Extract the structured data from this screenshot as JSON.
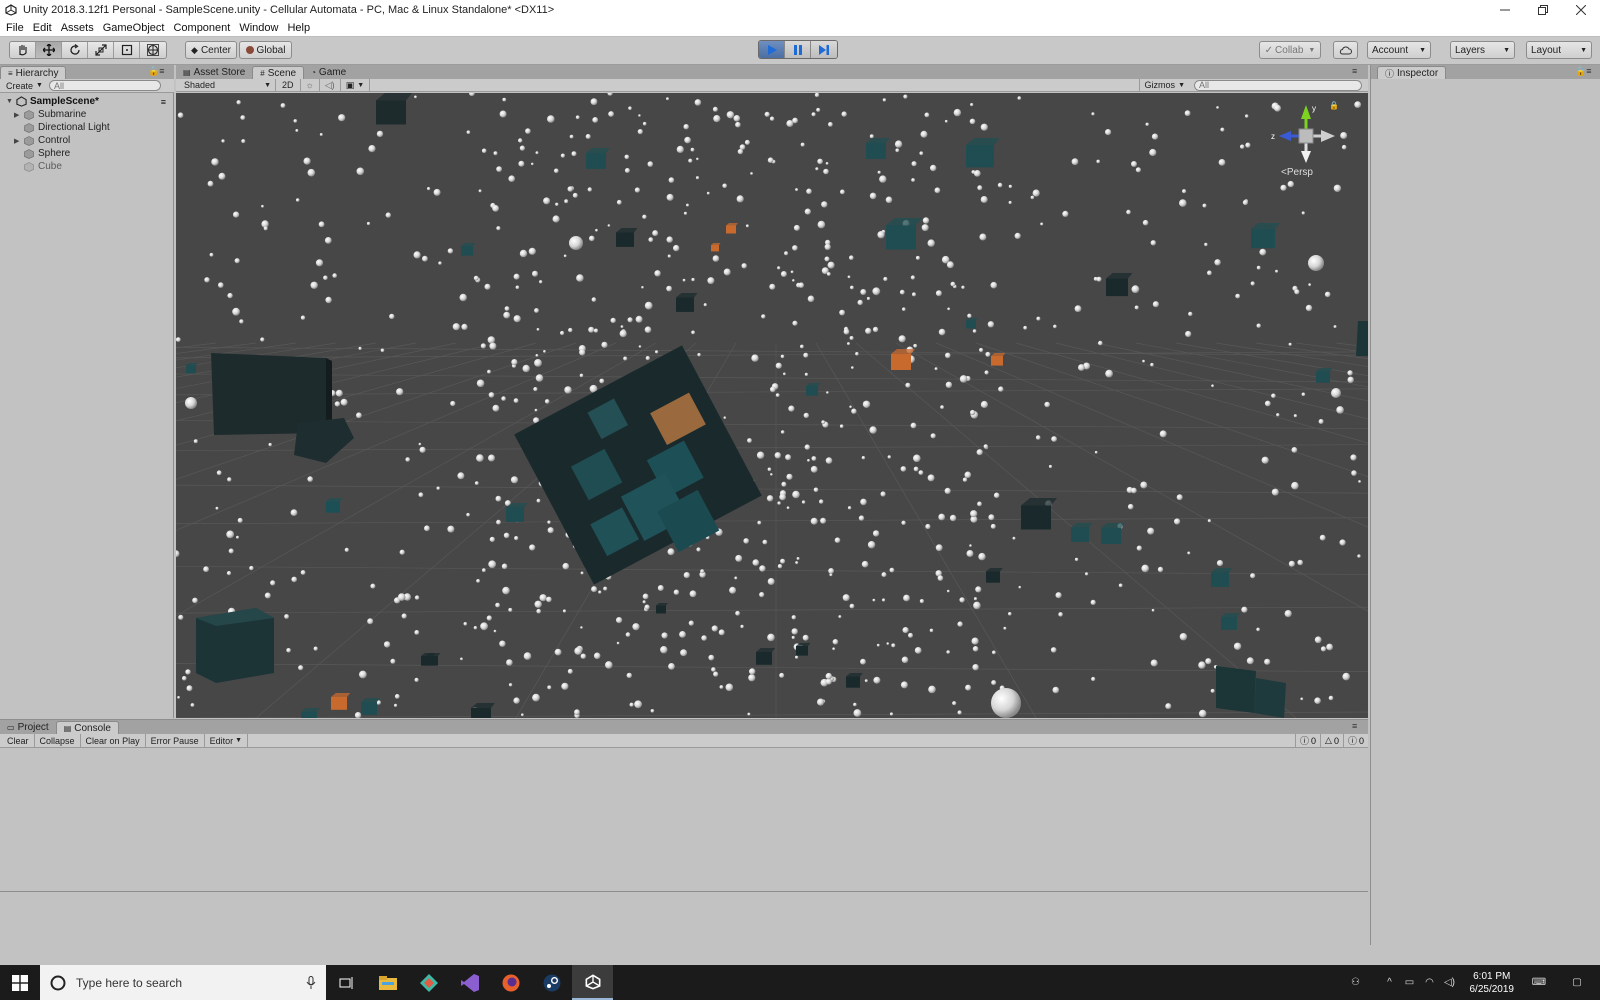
{
  "window": {
    "title": "Unity 2018.3.12f1 Personal - SampleScene.unity - Cellular Automata - PC, Mac & Linux Standalone* <DX11>",
    "controls": [
      "minimize",
      "restore",
      "close"
    ]
  },
  "menu": [
    "File",
    "Edit",
    "Assets",
    "GameObject",
    "Component",
    "Window",
    "Help"
  ],
  "toolbar": {
    "tools": [
      "hand-tool",
      "move-tool",
      "rotate-tool",
      "scale-tool",
      "rect-tool",
      "transform-tool"
    ],
    "active_tool": "move-tool",
    "pivot_label": "Center",
    "space_label": "Global",
    "play_state": "playing",
    "collab_label": "Collab",
    "account_label": "Account",
    "layers_label": "Layers",
    "layout_label": "Layout"
  },
  "hierarchy": {
    "tab_label": "Hierarchy",
    "create_label": "Create",
    "search_placeholder": "All",
    "scene_name": "SampleScene*",
    "items": [
      {
        "label": "Submarine",
        "has_children": true
      },
      {
        "label": "Directional Light",
        "has_children": false
      },
      {
        "label": "Control",
        "has_children": true
      },
      {
        "label": "Sphere",
        "has_children": false
      },
      {
        "label": "Cube",
        "has_children": false
      }
    ]
  },
  "scene_panel": {
    "tabs": [
      {
        "label": "Asset Store",
        "icon": "store-icon",
        "active": false
      },
      {
        "label": "Scene",
        "icon": "grid-icon",
        "active": true
      },
      {
        "label": "Game",
        "icon": "pacman-icon",
        "active": false
      }
    ],
    "draw_mode": "Shaded",
    "mode_2d_label": "2D",
    "gizmos_label": "Gizmos",
    "search_placeholder": "All",
    "projection_label": "Persp",
    "gizmo_axes": {
      "y": "y",
      "z": "z"
    },
    "colors": {
      "background": "#474747",
      "teal_cube": "#1f4d52",
      "dark_cube": "#1a2a2c",
      "orange_cube": "#c86a2e",
      "sphere": "#e6e6e6"
    }
  },
  "inspector": {
    "tab_label": "Inspector"
  },
  "console_panel": {
    "tabs": [
      {
        "label": "Project",
        "active": false
      },
      {
        "label": "Console",
        "active": true
      }
    ],
    "buttons": [
      "Clear",
      "Collapse",
      "Clear on Play",
      "Error Pause",
      "Editor"
    ],
    "counts": {
      "info": "0",
      "warning": "0",
      "error": "0"
    }
  },
  "taskbar": {
    "search_placeholder": "Type here to search",
    "apps": [
      "task-view-icon",
      "file-explorer-icon",
      "gitkraken-icon",
      "visual-studio-icon",
      "firefox-icon",
      "steam-icon",
      "unity-icon"
    ],
    "time": "6:01 PM",
    "date": "6/25/2019"
  }
}
